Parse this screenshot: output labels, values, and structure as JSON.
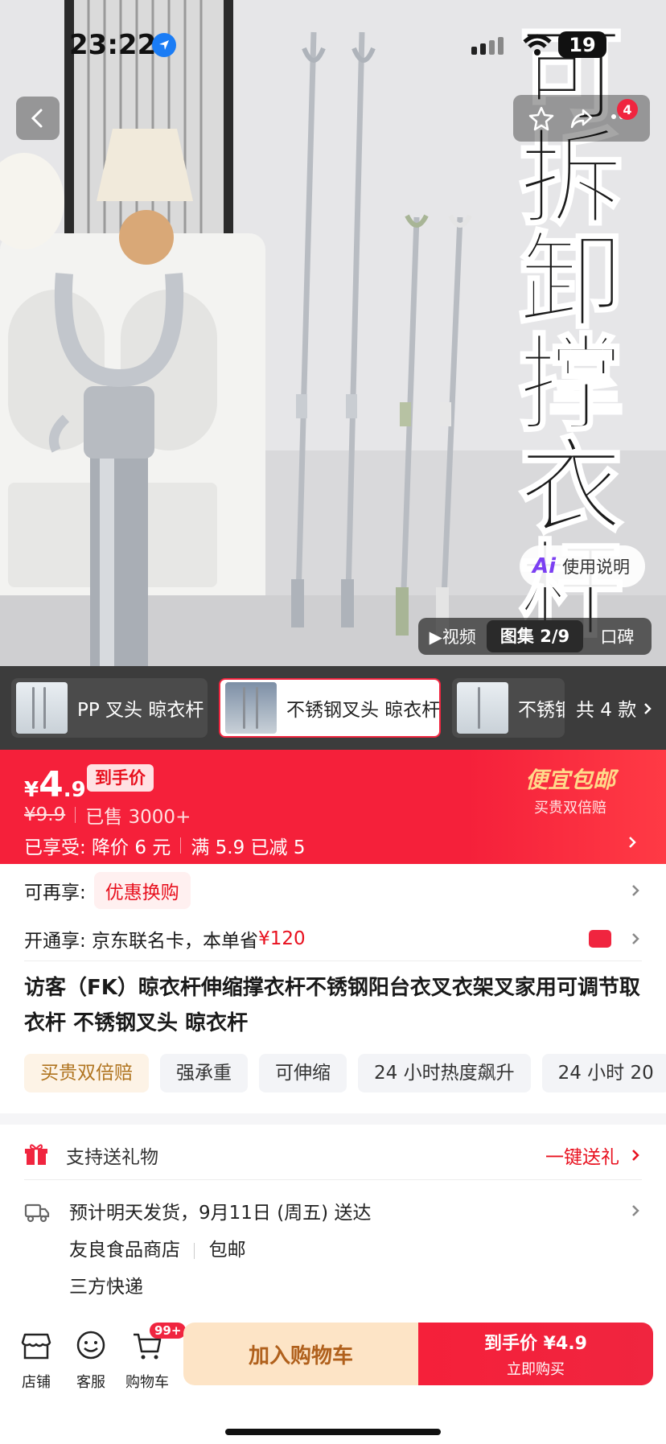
{
  "status_bar": {
    "time": "23:22",
    "battery": "19"
  },
  "hero": {
    "title_vertical": [
      "可",
      "拆",
      "卸",
      "撑",
      "衣",
      "杆"
    ],
    "cart_badge_count": "4",
    "ai_button_label": "使用说明",
    "ai_glyph": "Ai",
    "media_tabs": [
      {
        "label": "▶视频",
        "active": false
      },
      {
        "label": "图集 2/9",
        "active": true
      },
      {
        "label": "口碑",
        "active": false
      }
    ]
  },
  "variants": {
    "items": [
      {
        "label": "PP 叉头 晾衣杆",
        "selected": false
      },
      {
        "label": "不锈钢叉头 晾衣杆",
        "selected": true
      },
      {
        "label": "不锈钢",
        "selected": false
      }
    ],
    "count_label": "共 4 款"
  },
  "price": {
    "currency": "¥",
    "integer": "4",
    "decimal": ".9",
    "tag": "到手价",
    "original": "¥9.9",
    "sold": "已售 3000+",
    "discount_prefix": "已享受: 降价 6 元",
    "discount_threshold": "满 5.9 已减 5",
    "freeship_title": "便宜包邮",
    "freeship_sub": "买贵双倍赔"
  },
  "promo": {
    "label": "可再享:",
    "chip": "优惠换购",
    "card_prefix": "开通享: 京东联名卡，本单省",
    "card_amount": "¥120"
  },
  "product": {
    "title": "访客（FK）晾衣杆伸缩撑衣杆不锈钢阳台衣叉衣架叉家用可调节取衣杆 不锈钢叉头 晾衣杆",
    "tags": [
      "买贵双倍赔",
      "强承重",
      "可伸缩",
      "24 小时热度飙升",
      "24 小时 20"
    ]
  },
  "gift": {
    "label": "支持送礼物",
    "action": "一键送礼"
  },
  "delivery": {
    "eta": "预计明天发货，9月11日 (周五) 送达",
    "store": "友良食品商店",
    "shipping": "包邮",
    "carrier": "三方快递"
  },
  "bottom_bar": {
    "store": "店铺",
    "service": "客服",
    "cart": "购物车",
    "cart_badge": "99+",
    "add_to_cart": "加入购物车",
    "buy_line1": "到手价 ¥4.9",
    "buy_line2": "立即购买"
  },
  "colors": {
    "accent": "#f0253f",
    "price_bg": "#f5203a",
    "gold": "#b0741f"
  }
}
